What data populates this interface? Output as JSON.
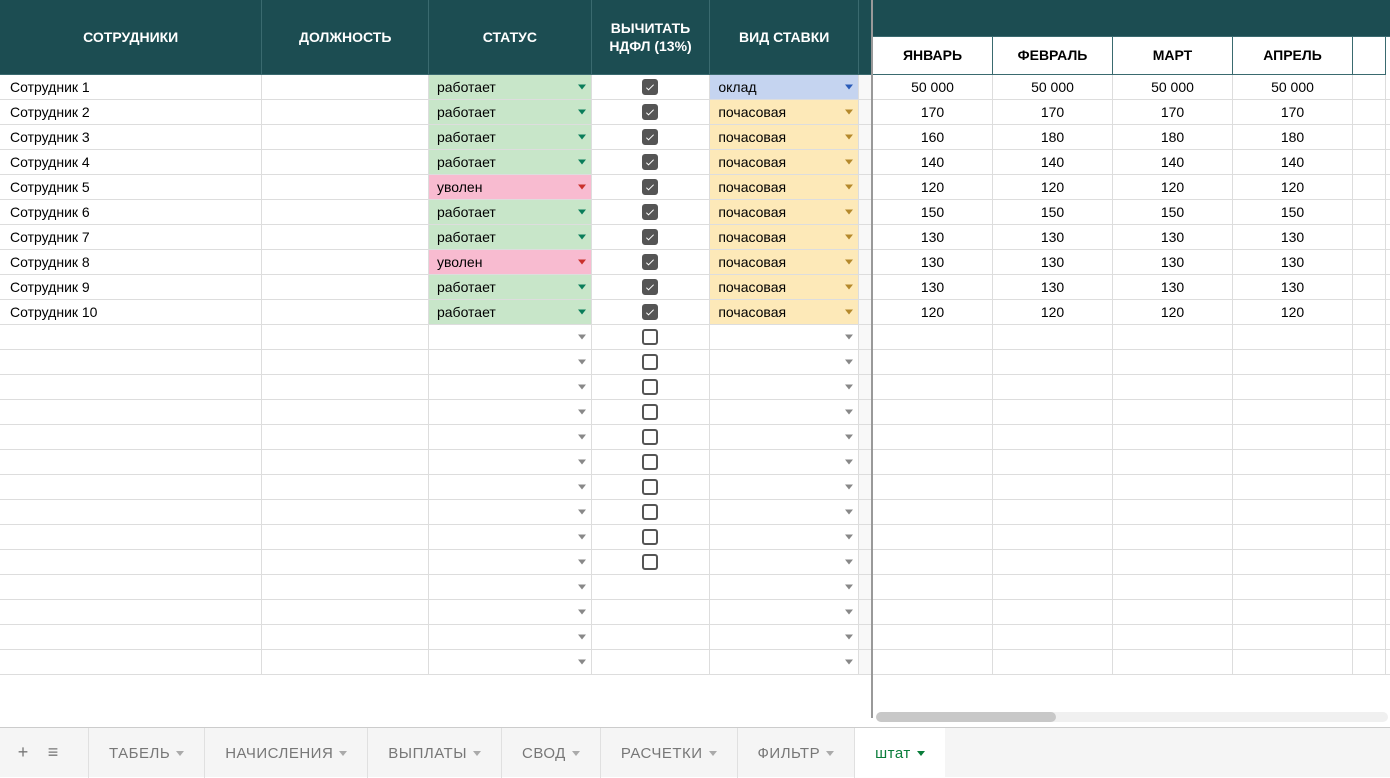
{
  "headers": {
    "employees": "СОТРУДНИКИ",
    "position": "ДОЛЖНОСТЬ",
    "status": "СТАТУС",
    "ndfl": "ВЫЧИТАТЬ НДФЛ (13%)",
    "rate_type": "ВИД СТАВКИ",
    "months": [
      "ЯНВАРЬ",
      "ФЕВРАЛЬ",
      "МАРТ",
      "АПРЕЛЬ"
    ]
  },
  "status_labels": {
    "work": "работает",
    "fired": "уволен"
  },
  "rate_labels": {
    "oklad": "оклад",
    "hourly": "почасовая"
  },
  "rows": [
    {
      "name": "Сотрудник 1",
      "status": "work",
      "ndfl": true,
      "rate": "oklad",
      "vals": [
        "50 000",
        "50 000",
        "50 000",
        "50 000"
      ]
    },
    {
      "name": "Сотрудник 2",
      "status": "work",
      "ndfl": true,
      "rate": "hourly",
      "vals": [
        "170",
        "170",
        "170",
        "170"
      ]
    },
    {
      "name": "Сотрудник 3",
      "status": "work",
      "ndfl": true,
      "rate": "hourly",
      "vals": [
        "160",
        "180",
        "180",
        "180"
      ]
    },
    {
      "name": "Сотрудник 4",
      "status": "work",
      "ndfl": true,
      "rate": "hourly",
      "vals": [
        "140",
        "140",
        "140",
        "140"
      ]
    },
    {
      "name": "Сотрудник 5",
      "status": "fired",
      "ndfl": true,
      "rate": "hourly",
      "vals": [
        "120",
        "120",
        "120",
        "120"
      ]
    },
    {
      "name": "Сотрудник 6",
      "status": "work",
      "ndfl": true,
      "rate": "hourly",
      "vals": [
        "150",
        "150",
        "150",
        "150"
      ]
    },
    {
      "name": "Сотрудник 7",
      "status": "work",
      "ndfl": true,
      "rate": "hourly",
      "vals": [
        "130",
        "130",
        "130",
        "130"
      ]
    },
    {
      "name": "Сотрудник 8",
      "status": "fired",
      "ndfl": true,
      "rate": "hourly",
      "vals": [
        "130",
        "130",
        "130",
        "130"
      ]
    },
    {
      "name": "Сотрудник 9",
      "status": "work",
      "ndfl": true,
      "rate": "hourly",
      "vals": [
        "130",
        "130",
        "130",
        "130"
      ]
    },
    {
      "name": "Сотрудник 10",
      "status": "work",
      "ndfl": true,
      "rate": "hourly",
      "vals": [
        "120",
        "120",
        "120",
        "120"
      ]
    }
  ],
  "empty_rows_with_checkbox": 10,
  "empty_rows_no_checkbox": 4,
  "tabs": [
    {
      "label": "ТАБЕЛЬ",
      "active": false
    },
    {
      "label": "НАЧИСЛЕНИЯ",
      "active": false
    },
    {
      "label": "ВЫПЛАТЫ",
      "active": false
    },
    {
      "label": "СВОД",
      "active": false
    },
    {
      "label": "РАСЧЕТКИ",
      "active": false
    },
    {
      "label": "ФИЛЬТР",
      "active": false
    },
    {
      "label": "штат",
      "active": true
    }
  ]
}
